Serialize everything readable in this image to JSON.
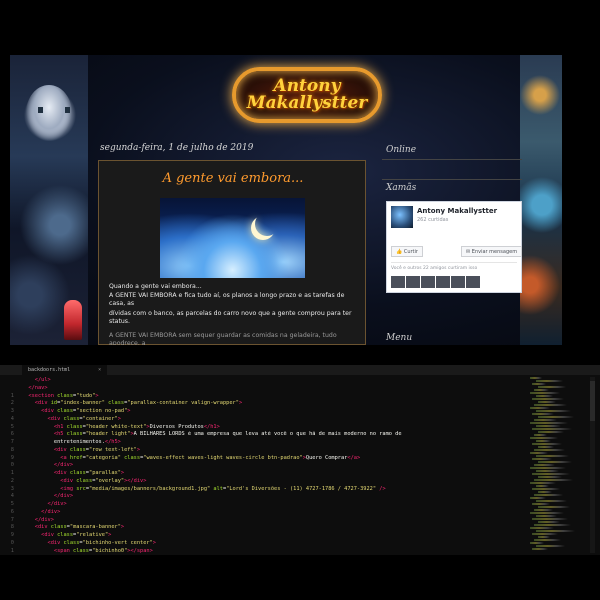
{
  "blog": {
    "logo_line1": "Antony",
    "logo_line2": "Makallystter",
    "post_date": "segunda-feira, 1 de julho de 2019",
    "post_title": "A gente vai embora...",
    "post_lines": [
      "Quando a gente vai embora...",
      "A GENTE VAI EMBORA e fica tudo aí, os planos a longo prazo e as tarefas de casa, as",
      "dívidas com o banco, as parcelas do carro novo que a gente comprou para ter status."
    ],
    "post_more": "A GENTE VAI EMBORA sem sequer guardar as comidas na geladeira, tudo apodrece, a",
    "widget_online": "Online",
    "widget_xamas": "Xamãs",
    "widget_menu": "Menu",
    "fb_name": "Antony Makallystter",
    "fb_likes": "262 curtidas",
    "fb_like_btn": "Curtir",
    "fb_msg_btn": "Enviar mensagem",
    "fb_friends": "Você e outros 22 amigos curtiram isso"
  },
  "editor": {
    "tab_name": "backdoors.html",
    "tab_close": "×",
    "line_numbers": [
      "",
      "",
      "1",
      "2",
      "3",
      "4",
      "5",
      "6",
      "7",
      "8",
      "9",
      "0",
      "1",
      "2",
      "3",
      "4",
      "5",
      "6",
      "7",
      "8",
      "9",
      "0",
      "1"
    ],
    "code_lines": [
      [
        [
          "p",
          "    "
        ],
        [
          "t",
          "</ul>"
        ]
      ],
      [
        [
          "p",
          "  "
        ],
        [
          "t",
          "</nav>"
        ]
      ],
      [
        [
          "p",
          "  "
        ],
        [
          "t",
          "<section "
        ],
        [
          "a",
          "class"
        ],
        [
          "p",
          "="
        ],
        [
          "s",
          "\"tudo\""
        ],
        [
          "t",
          ">"
        ]
      ],
      [
        [
          "p",
          "    "
        ],
        [
          "t",
          "<div "
        ],
        [
          "a",
          "id"
        ],
        [
          "p",
          "="
        ],
        [
          "s",
          "\"index-banner\" "
        ],
        [
          "a",
          "class"
        ],
        [
          "p",
          "="
        ],
        [
          "s",
          "\"parallax-container valign-wrapper\""
        ],
        [
          "t",
          ">"
        ]
      ],
      [
        [
          "p",
          "      "
        ],
        [
          "t",
          "<div "
        ],
        [
          "a",
          "class"
        ],
        [
          "p",
          "="
        ],
        [
          "s",
          "\"section no-pad\""
        ],
        [
          "t",
          ">"
        ]
      ],
      [
        [
          "p",
          "        "
        ],
        [
          "t",
          "<div "
        ],
        [
          "a",
          "class"
        ],
        [
          "p",
          "="
        ],
        [
          "s",
          "\"container\""
        ],
        [
          "t",
          ">"
        ]
      ],
      [
        [
          "p",
          "          "
        ],
        [
          "t",
          "<h1 "
        ],
        [
          "a",
          "class"
        ],
        [
          "p",
          "="
        ],
        [
          "s",
          "\"header white-text\""
        ],
        [
          "t",
          ">"
        ],
        [
          "p",
          "Diversos Produtos"
        ],
        [
          "t",
          "</h1>"
        ]
      ],
      [
        [
          "p",
          "          "
        ],
        [
          "t",
          "<h5 "
        ],
        [
          "a",
          "class"
        ],
        [
          "p",
          "="
        ],
        [
          "s",
          "\"header light\""
        ],
        [
          "t",
          ">"
        ],
        [
          "p",
          "A BILHARES LORDS é uma empresa que leva até você o que há de mais moderno no ramo de"
        ]
      ],
      [
        [
          "p",
          "          entretenimentos."
        ],
        [
          "t",
          "</h5>"
        ]
      ],
      [
        [
          "p",
          "          "
        ],
        [
          "t",
          "<div "
        ],
        [
          "a",
          "class"
        ],
        [
          "p",
          "="
        ],
        [
          "s",
          "\"row text-left\""
        ],
        [
          "t",
          ">"
        ]
      ],
      [
        [
          "p",
          "            "
        ],
        [
          "t",
          "<a "
        ],
        [
          "a",
          "href"
        ],
        [
          "p",
          "="
        ],
        [
          "s",
          "\"categoria\" "
        ],
        [
          "a",
          "class"
        ],
        [
          "p",
          "="
        ],
        [
          "s",
          "\"waves-effect waves-light waves-circle btn-padrao\""
        ],
        [
          "t",
          ">"
        ],
        [
          "p",
          "Quero Comprar"
        ],
        [
          "t",
          "</a>"
        ]
      ],
      [
        [
          "p",
          "          "
        ],
        [
          "t",
          "</div>"
        ]
      ],
      [
        [
          "p",
          "          "
        ],
        [
          "t",
          "<div "
        ],
        [
          "a",
          "class"
        ],
        [
          "p",
          "="
        ],
        [
          "s",
          "\"parallax\""
        ],
        [
          "t",
          ">"
        ]
      ],
      [
        [
          "p",
          "            "
        ],
        [
          "t",
          "<div "
        ],
        [
          "a",
          "class"
        ],
        [
          "p",
          "="
        ],
        [
          "s",
          "\"overlay\""
        ],
        [
          "t",
          "></div>"
        ]
      ],
      [
        [
          "p",
          "            "
        ],
        [
          "t",
          "<img "
        ],
        [
          "a",
          "src"
        ],
        [
          "p",
          "="
        ],
        [
          "s",
          "\"media/images/banners/background1.jpg\" "
        ],
        [
          "a",
          "alt"
        ],
        [
          "p",
          "="
        ],
        [
          "s",
          "\"Lord's Diversões - (11) 4727-1786 / 4727-3922\" "
        ],
        [
          "t",
          "/>"
        ]
      ],
      [
        [
          "p",
          "          "
        ],
        [
          "t",
          "</div>"
        ]
      ],
      [
        [
          "p",
          "        "
        ],
        [
          "t",
          "</div>"
        ]
      ],
      [
        [
          "p",
          "      "
        ],
        [
          "t",
          "</div>"
        ]
      ],
      [
        [
          "p",
          "    "
        ],
        [
          "t",
          "</div>"
        ]
      ],
      [
        [
          "p",
          "    "
        ],
        [
          "t",
          "<div "
        ],
        [
          "a",
          "class"
        ],
        [
          "p",
          "="
        ],
        [
          "s",
          "\"mascara-banner\""
        ],
        [
          "t",
          ">"
        ]
      ],
      [
        [
          "p",
          "      "
        ],
        [
          "t",
          "<div "
        ],
        [
          "a",
          "class"
        ],
        [
          "p",
          "="
        ],
        [
          "s",
          "\"relative\""
        ],
        [
          "t",
          ">"
        ]
      ],
      [
        [
          "p",
          "        "
        ],
        [
          "t",
          "<div "
        ],
        [
          "a",
          "class"
        ],
        [
          "p",
          "="
        ],
        [
          "s",
          "\"bichinho-vert center\""
        ],
        [
          "t",
          ">"
        ]
      ],
      [
        [
          "p",
          "          "
        ],
        [
          "t",
          "<span "
        ],
        [
          "a",
          "class"
        ],
        [
          "p",
          "="
        ],
        [
          "s",
          "\"bichinho0\""
        ],
        [
          "t",
          "></span>"
        ]
      ]
    ]
  }
}
